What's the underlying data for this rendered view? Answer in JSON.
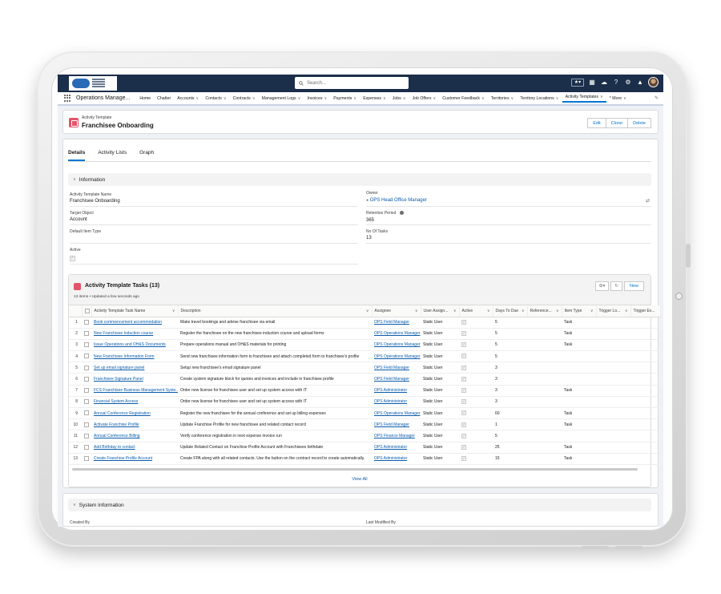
{
  "header": {
    "search_placeholder": "Search..."
  },
  "nav": {
    "app_name": "Operations Manage...",
    "items": [
      {
        "label": "Home",
        "dropdown": false
      },
      {
        "label": "Chatter",
        "dropdown": false
      },
      {
        "label": "Accounts",
        "dropdown": true
      },
      {
        "label": "Contacts",
        "dropdown": true
      },
      {
        "label": "Contracts",
        "dropdown": true
      },
      {
        "label": "Management Logs",
        "dropdown": true
      },
      {
        "label": "Invoices",
        "dropdown": true
      },
      {
        "label": "Payments",
        "dropdown": true
      },
      {
        "label": "Expenses",
        "dropdown": true
      },
      {
        "label": "Jobs",
        "dropdown": true
      },
      {
        "label": "Job Offers",
        "dropdown": true
      },
      {
        "label": "Customer Feedback",
        "dropdown": true
      },
      {
        "label": "Territories",
        "dropdown": true
      },
      {
        "label": "Territory Locations",
        "dropdown": true
      },
      {
        "label": "Activity Templates",
        "dropdown": true,
        "active": true
      },
      {
        "label": "* More",
        "dropdown": true
      }
    ]
  },
  "record": {
    "type": "Activity Template",
    "title": "Franchisee Onboarding",
    "buttons": [
      "Edit",
      "Clone",
      "Delete"
    ]
  },
  "tabs": [
    "Details",
    "Activity Lists",
    "Graph"
  ],
  "information": {
    "section_title": "Information",
    "fields": {
      "name_label": "Activity Template Name",
      "name_value": "Franchisee Onboarding",
      "owner_label": "Owner",
      "owner_value": "OPS Head Office Manager",
      "target_label": "Target Object",
      "target_value": "Account",
      "retention_label": "Retention Period",
      "retention_value": "365",
      "default_type_label": "Default Item Type",
      "default_type_value": "",
      "no_tasks_label": "No Of Tasks",
      "no_tasks_value": "13",
      "active_label": "Active"
    }
  },
  "related_list": {
    "title": "Activity Template Tasks (13)",
    "subtitle": "13 items • Updated a few seconds ago",
    "new_label": "New",
    "columns": [
      "Activity Template Task Name",
      "Description",
      "Assignee",
      "User Assign...",
      "Active",
      "Days To Due",
      "Reference...",
      "Item Type",
      "Trigger Lo...",
      "Trigger Ex..."
    ],
    "rows": [
      {
        "n": "1",
        "name": "Book commencement accommodation",
        "desc": "Make travel bookings and advise franchisee via email",
        "assignee": "OPS Field Manager",
        "ua": "Static User",
        "days": "5",
        "type": "Task"
      },
      {
        "n": "2",
        "name": "New Franchisee Induction course",
        "desc": "Register the franchisee on the new franchisee induction course and upload forms",
        "assignee": "OPS Operations Manager",
        "ua": "Static User",
        "days": "5",
        "type": "Task"
      },
      {
        "n": "3",
        "name": "Issue Operations and OH&S Documents",
        "desc": "Prepare operations manual and OH&S materials for printing",
        "assignee": "OPS Operations Manager",
        "ua": "Static User",
        "days": "5",
        "type": "Task"
      },
      {
        "n": "4",
        "name": "New Franchisee Information Form",
        "desc": "Send new franchisee information form to franchisee and attach completed form to franchisee's profile",
        "assignee": "OPS Operations Manager",
        "ua": "Static User",
        "days": "5",
        "type": ""
      },
      {
        "n": "5",
        "name": "Set up email signature panel",
        "desc": "Setup new franchisee's email signature panel",
        "assignee": "OPS Field Manager",
        "ua": "Static User",
        "days": "3",
        "type": ""
      },
      {
        "n": "6",
        "name": "Franchisee Signature Panel",
        "desc": "Create system signature block for quotes and invoices and include in franchisee profile",
        "assignee": "OPS Field Manager",
        "ua": "Static User",
        "days": "3",
        "type": ""
      },
      {
        "n": "7",
        "name": "FCS Franchisee Business Management Syste...",
        "desc": "Order new license for franchisee user and set up system access with IT",
        "assignee": "OPS Administrator",
        "ua": "Static User",
        "days": "3",
        "type": "Task"
      },
      {
        "n": "8",
        "name": "Financial System Access",
        "desc": "Order new license for franchisee user and set up system access with IT",
        "assignee": "OPS Administrator",
        "ua": "Static User",
        "days": "3",
        "type": ""
      },
      {
        "n": "9",
        "name": "Annual Conference Registration",
        "desc": "Register the new franchisee for the annual conference and set up billing expenses",
        "assignee": "OPS Operations Manager",
        "ua": "Static User",
        "days": "60",
        "type": "Task"
      },
      {
        "n": "10",
        "name": "Activate Franchise Profile",
        "desc": "Update Franchise Profile for new franchisee and related contact record",
        "assignee": "OPS Field Manager",
        "ua": "Static User",
        "days": "1",
        "type": "Task"
      },
      {
        "n": "11",
        "name": "Annual Conference Billing",
        "desc": "Verify conference registration in next expense invoice run",
        "assignee": "OPS Finance Manager",
        "ua": "Static User",
        "days": "5",
        "type": ""
      },
      {
        "n": "12",
        "name": "Add Birthday to contact",
        "desc": "Update Related Contact on Franchise Profile Account with Franchisees birthdate",
        "assignee": "OPS Administrator",
        "ua": "Static User",
        "days": "25",
        "type": "Task"
      },
      {
        "n": "13",
        "name": "Create Franchise Profile Account",
        "desc": "Create FPA along with all related contacts. Use the button on the contract record to create automatically.",
        "assignee": "OPS Administrator",
        "ua": "Static User",
        "days": "15",
        "type": "Task"
      }
    ],
    "view_all": "View All"
  },
  "system_info": {
    "section_title": "System Information",
    "created_by_label": "Created By",
    "modified_by_label": "Last Modified By"
  }
}
